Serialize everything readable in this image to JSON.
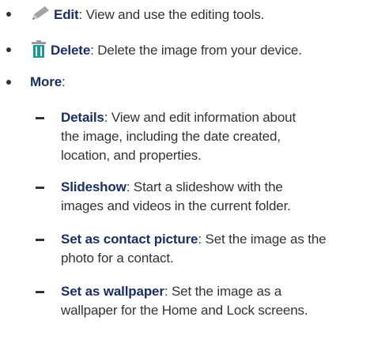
{
  "items": [
    {
      "icon": "pencil-icon",
      "term": "Edit",
      "description": ": View and use the editing tools."
    },
    {
      "icon": "trash-icon",
      "term": "Delete",
      "description": ": Delete the image from your device."
    },
    {
      "term": "More",
      "description": ":",
      "subitems": [
        {
          "term": "Details",
          "lines": [
            ": View and edit information about",
            "the image, including the date created,",
            "location, and properties."
          ]
        },
        {
          "term": "Slideshow",
          "lines": [
            ": Start a slideshow with the",
            "images and videos in the current folder."
          ]
        },
        {
          "term": "Set as contact picture",
          "lines": [
            ": Set the image as the",
            "photo for a contact."
          ]
        },
        {
          "term": "Set as wallpaper",
          "lines": [
            ": Set the image as a",
            "wallpaper for the Home and Lock screens."
          ]
        }
      ]
    }
  ],
  "colors": {
    "text": "#333333",
    "term": "#1a2f63",
    "icon_gray": "#9a9a9a",
    "icon_green": "#1a9a92"
  }
}
